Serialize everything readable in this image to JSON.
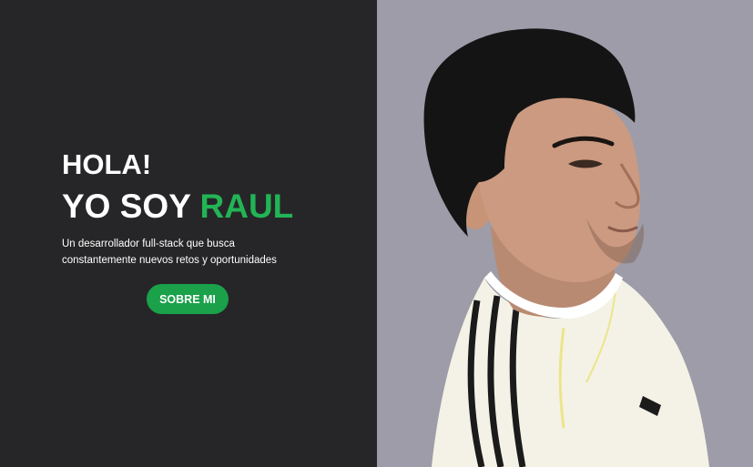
{
  "hero": {
    "greeting": "HOLA!",
    "name_prefix": "YO SOY ",
    "name": "RAUL",
    "description": "Un desarrollador full-stack que busca constantemente nuevos retos y oportunidades",
    "cta_label": "SOBRE MI"
  },
  "colors": {
    "left_background": "#262628",
    "right_background": "#9d9ca8",
    "accent": "#22b455",
    "button": "#1aa14a",
    "text": "#ffffff"
  }
}
